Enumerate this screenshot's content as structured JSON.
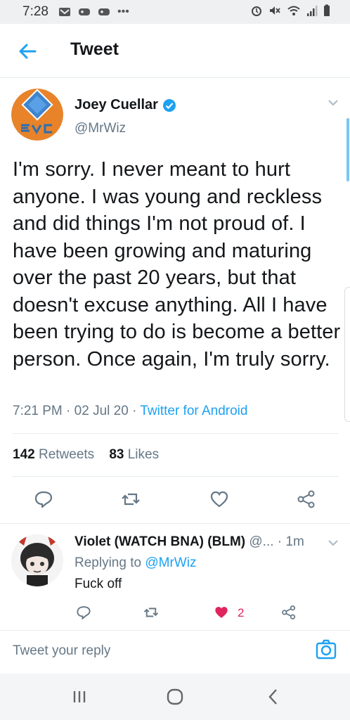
{
  "status_bar": {
    "time": "7:28",
    "left_icons": [
      "mail-icon",
      "game-controller-icon",
      "game-controller-icon",
      "more-dots-icon"
    ],
    "right_icons": [
      "alarm-icon",
      "mute-icon",
      "wifi-icon",
      "signal-icon",
      "battery-icon"
    ]
  },
  "header": {
    "title": "Tweet",
    "back_icon": "back-arrow-icon"
  },
  "tweet": {
    "author_name": "Joey Cuellar",
    "author_handle": "@MrWiz",
    "verified": true,
    "text": "I'm sorry. I never meant to hurt anyone.  I was young and reckless and did things I'm not proud of. I have been growing and maturing over the past 20 years, but that doesn't excuse anything. All I have been trying to do is become a better person. Once again, I'm truly sorry.",
    "time": "7:21 PM",
    "date": "02 Jul 20",
    "source": "Twitter for Android",
    "retweets": "142",
    "retweets_label": "Retweets",
    "likes": "83",
    "likes_label": "Likes",
    "separator": "·"
  },
  "reply": {
    "name": "Violet (WATCH BNA) (BLM)",
    "handle_trunc": "@...",
    "time": "1m",
    "replying_to_label": "Replying to",
    "replying_to_handle": "@MrWiz",
    "text": "Fuck off",
    "like_count": "2"
  },
  "compose": {
    "placeholder": "Tweet your reply"
  },
  "colors": {
    "accent": "#1da1f2",
    "like": "#e0245e",
    "muted": "#657786",
    "evo_orange": "#e8832a",
    "evo_blue": "#2a6fb5"
  }
}
